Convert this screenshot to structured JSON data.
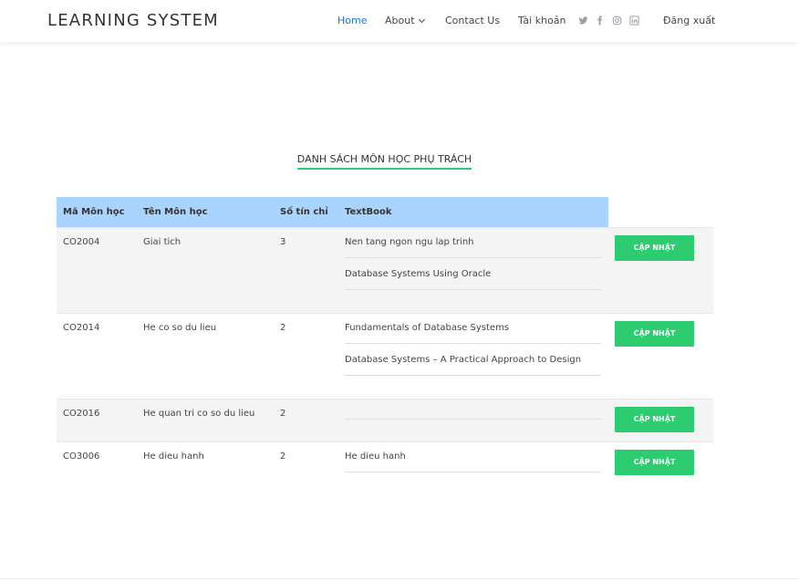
{
  "header": {
    "brand": "LEARNING SYSTEM",
    "nav": {
      "home": "Home",
      "about": "About",
      "contact": "Contact Us",
      "account": "Tài khoản",
      "logout": "Đăng xuất"
    },
    "social_icons": [
      "twitter-icon",
      "facebook-icon",
      "instagram-icon",
      "linkedin-icon"
    ]
  },
  "page": {
    "title": "DANH SÁCH MÔN HỌC PHỤ TRÁCH"
  },
  "table": {
    "headers": {
      "code": "Mã Môn học",
      "name": "Tên Môn học",
      "credits": "Số tín chỉ",
      "textbook": "TextBook"
    },
    "update_label": "CẬP NHẬT",
    "rows": [
      {
        "code": "CO2004",
        "name": "Giai tich",
        "credits": "3",
        "textbooks": [
          "Nen tang ngon ngu lap trinh",
          "Database Systems Using Oracle"
        ]
      },
      {
        "code": "CO2014",
        "name": "He co so du lieu",
        "credits": "2",
        "textbooks": [
          "Fundamentals of Database Systems",
          "Database Systems – A Practical Approach to Design"
        ]
      },
      {
        "code": "CO2016",
        "name": "He quan tri co so du lieu",
        "credits": "2",
        "textbooks": [
          ""
        ]
      },
      {
        "code": "CO3006",
        "name": "He dieu hanh",
        "credits": "2",
        "textbooks": [
          "He dieu hanh"
        ]
      }
    ]
  },
  "colors": {
    "accent_green": "#2ecc71",
    "header_blue": "#a8d4ff",
    "nav_active": "#1a73e8"
  }
}
